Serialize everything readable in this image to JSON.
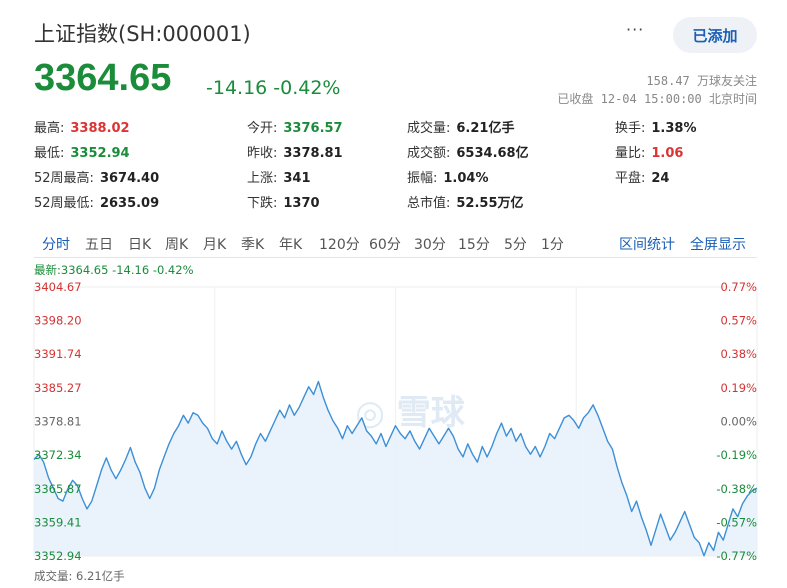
{
  "header": {
    "title": "上证指数(SH:000001)",
    "more_icon": "more-dots-icon",
    "follow_label": "已添加"
  },
  "quote": {
    "price": "3364.65",
    "change": "-14.16",
    "change_pct": "-0.42%",
    "followers": "158.47 万球友关注",
    "status": "已收盘 12-04 15:00:00 北京时间"
  },
  "stats": [
    [
      {
        "label": "最高:",
        "value": "3388.02",
        "tone": "red"
      },
      {
        "label": "今开:",
        "value": "3376.57",
        "tone": "green"
      },
      {
        "label": "成交量:",
        "value": "6.21亿手",
        "tone": ""
      },
      {
        "label": "换手:",
        "value": "1.38%",
        "tone": ""
      }
    ],
    [
      {
        "label": "最低:",
        "value": "3352.94",
        "tone": "green"
      },
      {
        "label": "昨收:",
        "value": "3378.81",
        "tone": ""
      },
      {
        "label": "成交额:",
        "value": "6534.68亿",
        "tone": ""
      },
      {
        "label": "量比:",
        "value": "1.06",
        "tone": "red"
      }
    ],
    [
      {
        "label": "52周最高:",
        "value": "3674.40",
        "tone": ""
      },
      {
        "label": "上涨:",
        "value": "341",
        "tone": ""
      },
      {
        "label": "振幅:",
        "value": "1.04%",
        "tone": ""
      },
      {
        "label": "平盘:",
        "value": "24",
        "tone": ""
      }
    ],
    [
      {
        "label": "52周最低:",
        "value": "2635.09",
        "tone": ""
      },
      {
        "label": "下跌:",
        "value": "1370",
        "tone": ""
      },
      {
        "label": "总市值:",
        "value": "52.55万亿",
        "tone": ""
      }
    ]
  ],
  "tabs": [
    "分时",
    "五日",
    "日K",
    "周K",
    "月K",
    "季K",
    "年K",
    "120分",
    "60分",
    "30分",
    "15分",
    "5分",
    "1分"
  ],
  "active_tab": 0,
  "tab_actions": [
    "区间统计",
    "全屏显示"
  ],
  "latest_line": "最新:3364.65 -14.16 -0.42%",
  "volume_line": "成交量: 6.21亿手",
  "colors": {
    "up": "#d33333",
    "down": "#1a8c3a",
    "accent": "#1a5fb4",
    "line": "#3d8fd6",
    "fill": "#e6f1fb"
  },
  "chart_data": {
    "type": "area",
    "y_ticks": [
      "3404.67",
      "3398.20",
      "3391.74",
      "3385.27",
      "3378.81",
      "3372.34",
      "3365.87",
      "3359.41",
      "3352.94"
    ],
    "pct_ticks": [
      "0.77%",
      "0.57%",
      "0.38%",
      "0.19%",
      "0.00%",
      "-0.19%",
      "-0.38%",
      "-0.57%",
      "-0.77%"
    ],
    "ylim": [
      3352.94,
      3404.67
    ],
    "prev_close": 3378.81,
    "series": [
      {
        "values": [
          3371.5,
          3372.5,
          3371.0,
          3368.0,
          3366.0,
          3364.0,
          3363.5,
          3365.8,
          3367.5,
          3366.5,
          3364.0,
          3362.0,
          3363.5,
          3366.5,
          3369.5,
          3371.8,
          3369.5,
          3367.8,
          3369.5,
          3371.5,
          3373.8,
          3371.0,
          3369.0,
          3366.0,
          3364.0,
          3366.0,
          3369.5,
          3372.0,
          3374.5,
          3376.5,
          3378.0,
          3380.0,
          3378.5,
          3380.5,
          3380.0,
          3378.5,
          3377.5,
          3375.5,
          3374.5,
          3377.0,
          3375.0,
          3373.5,
          3375.0,
          3372.5,
          3370.5,
          3372.0,
          3374.5,
          3376.5,
          3375.0,
          3377.0,
          3379.0,
          3381.0,
          3379.5,
          3382.0,
          3380.0,
          3381.5,
          3383.5,
          3385.5,
          3384.0,
          3386.5,
          3383.5,
          3381.0,
          3379.0,
          3377.5,
          3375.5,
          3378.0,
          3376.5,
          3378.0,
          3379.5,
          3377.0,
          3376.0,
          3374.5,
          3376.5,
          3374.0,
          3376.0,
          3378.0,
          3376.5,
          3375.5,
          3377.0,
          3375.0,
          3373.5,
          3375.5,
          3377.5,
          3376.0,
          3374.5,
          3376.0,
          3377.5,
          3376.0,
          3373.5,
          3372.0,
          3374.5,
          3372.5,
          3371.0,
          3374.0,
          3372.0,
          3374.0,
          3376.5,
          3378.5,
          3376.0,
          3377.5,
          3375.0,
          3376.5,
          3374.0,
          3372.5,
          3374.0,
          3372.0,
          3374.0,
          3376.5,
          3375.5,
          3377.5,
          3379.5,
          3380.0,
          3379.0,
          3377.5,
          3379.5,
          3380.5,
          3382.0,
          3380.0,
          3377.5,
          3375.0,
          3373.5,
          3370.0,
          3367.0,
          3364.5,
          3361.5,
          3363.5,
          3360.5,
          3358.0,
          3355.0,
          3358.0,
          3361.0,
          3358.5,
          3356.0,
          3357.5,
          3359.5,
          3361.5,
          3359.0,
          3356.5,
          3355.5,
          3353.0,
          3355.5,
          3354.0,
          3357.5,
          3356.0,
          3359.0,
          3362.0,
          3360.5,
          3363.0,
          3364.5,
          3365.5,
          3366.0
        ]
      }
    ]
  }
}
